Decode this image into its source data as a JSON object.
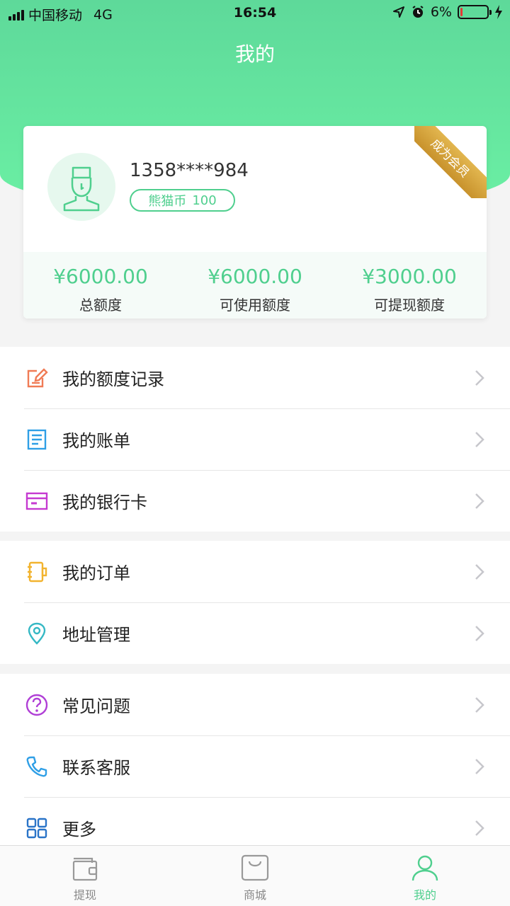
{
  "status_bar": {
    "carrier": "中国移动",
    "network": "4G",
    "time": "16:54",
    "battery": "6%"
  },
  "header": {
    "title": "我的"
  },
  "profile": {
    "phone": "1358****984",
    "coin_label": "熊猫币",
    "coin_value": "100",
    "vip_ribbon": "成为会员",
    "stats": [
      {
        "value": "¥6000.00",
        "label": "总额度"
      },
      {
        "value": "¥6000.00",
        "label": "可使用额度"
      },
      {
        "value": "¥3000.00",
        "label": "可提现额度"
      }
    ]
  },
  "menu": {
    "group1": [
      {
        "label": "我的额度记录",
        "icon": "edit-icon"
      },
      {
        "label": "我的账单",
        "icon": "bill-icon"
      },
      {
        "label": "我的银行卡",
        "icon": "bank-card-icon"
      }
    ],
    "group2": [
      {
        "label": "我的订单",
        "icon": "order-icon"
      },
      {
        "label": "地址管理",
        "icon": "location-icon"
      }
    ],
    "group3": [
      {
        "label": "常见问题",
        "icon": "question-icon"
      },
      {
        "label": "联系客服",
        "icon": "phone-icon"
      },
      {
        "label": "更多",
        "icon": "grid-icon"
      }
    ]
  },
  "tab_bar": {
    "tabs": [
      {
        "label": "提现",
        "icon": "wallet-icon",
        "active": false
      },
      {
        "label": "商城",
        "icon": "shopping-bag-icon",
        "active": false
      },
      {
        "label": "我的",
        "icon": "user-icon",
        "active": true
      }
    ]
  },
  "colors": {
    "accent": "#4fcf8e",
    "header_gradient_top": "#5ed99a",
    "header_gradient_bottom": "#6bf0a4",
    "ribbon_gold": "#d4a23c",
    "icon_orange": "#f07b55",
    "icon_blue": "#2f9fe6",
    "icon_magenta": "#c53ad1",
    "icon_yellow": "#f2b32e",
    "icon_teal": "#35b8c4",
    "icon_purple": "#b03fd6",
    "icon_navy": "#2a74c8"
  }
}
